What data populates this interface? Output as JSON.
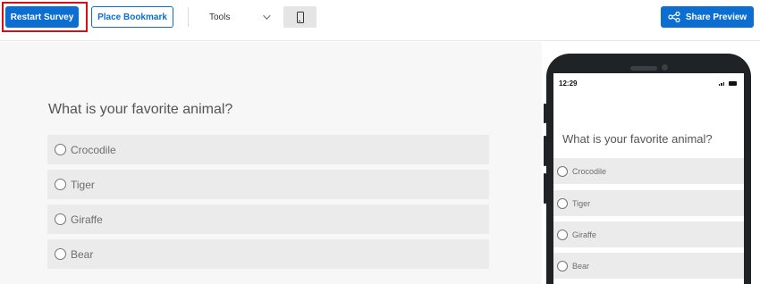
{
  "toolbar": {
    "restart_label": "Restart Survey",
    "bookmark_label": "Place Bookmark",
    "tools_label": "Tools",
    "share_label": "Share Preview"
  },
  "survey": {
    "question": "What is your favorite animal?",
    "choices": [
      "Crocodile",
      "Tiger",
      "Giraffe",
      "Bear"
    ]
  },
  "phone": {
    "time": "12:29"
  },
  "colors": {
    "accent": "#0b6ed0",
    "highlight": "#c4161c"
  }
}
